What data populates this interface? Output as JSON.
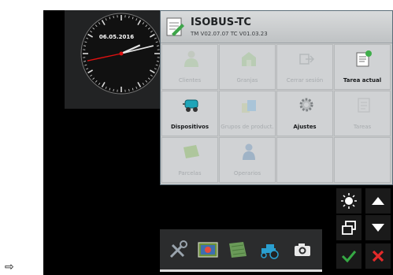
{
  "page": {
    "arrow_glyph": "⇨"
  },
  "clock": {
    "date": "06.05.2016",
    "hour": 2,
    "minute": 12,
    "second": 43
  },
  "app": {
    "title": "ISOBUS-TC",
    "version": "TM V02.07.07  TC V01.03.23",
    "tiles": [
      {
        "label": "Clientes",
        "icon": "person-icon",
        "enabled": false
      },
      {
        "label": "Granjas",
        "icon": "barn-icon",
        "enabled": false
      },
      {
        "label": "Cerrar sesión",
        "icon": "logout-icon",
        "enabled": false
      },
      {
        "label": "Tarea actual",
        "icon": "current-task-icon",
        "enabled": true
      },
      {
        "label": "Dispositivos",
        "icon": "sprayer-icon",
        "enabled": true
      },
      {
        "label": "Grupos de product.",
        "icon": "product-group-icon",
        "enabled": false
      },
      {
        "label": "Ajustes",
        "icon": "gear-icon",
        "enabled": true
      },
      {
        "label": "Tareas",
        "icon": "task-list-icon",
        "enabled": false
      },
      {
        "label": "Parcelas",
        "icon": "field-icon",
        "enabled": false
      },
      {
        "label": "Operarios",
        "icon": "operator-icon",
        "enabled": false
      }
    ]
  },
  "controls": [
    "brightness-icon",
    "arrow-up-icon",
    "window-switch-icon",
    "arrow-down-icon",
    "confirm-icon",
    "cancel-icon"
  ],
  "bottom_bar": [
    "tools-icon",
    "terminal-icon",
    "map-icon",
    "tractor-icon",
    "camera-icon"
  ],
  "colors": {
    "accent_green": "#35a843",
    "cancel_red": "#e32a2a",
    "screen_bg": "#000000"
  }
}
